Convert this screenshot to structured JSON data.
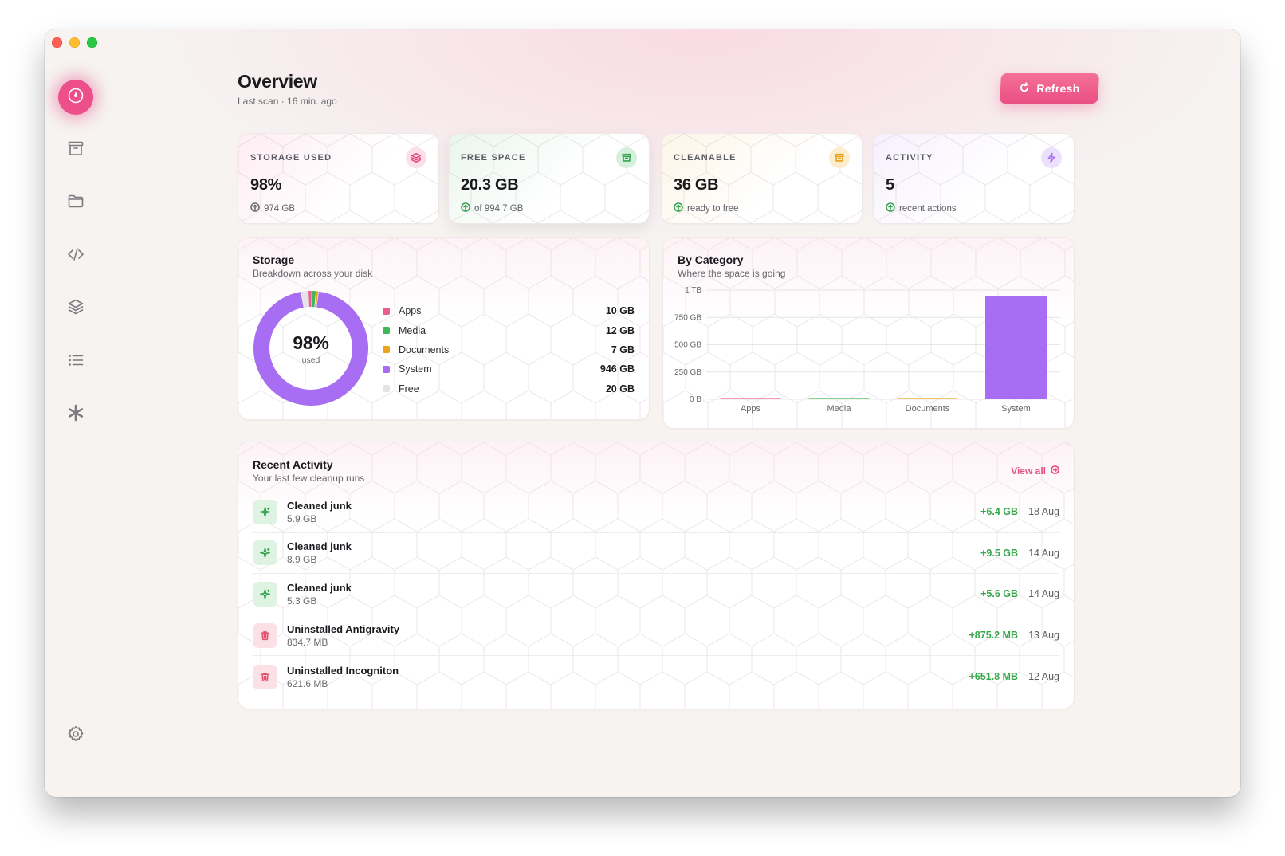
{
  "page": {
    "title": "Overview",
    "last_scan": "Last scan · 16 min. ago",
    "refresh_label": "Refresh"
  },
  "sidebar": {
    "items": [
      {
        "name": "dashboard",
        "icon": "gauge-icon",
        "active": true
      },
      {
        "name": "archive",
        "icon": "archive-icon",
        "active": false
      },
      {
        "name": "folders",
        "icon": "folder-icon",
        "active": false
      },
      {
        "name": "developer",
        "icon": "code-icon",
        "active": false
      },
      {
        "name": "layers",
        "icon": "layers-icon",
        "active": false
      },
      {
        "name": "list",
        "icon": "list-icon",
        "active": false
      },
      {
        "name": "extras",
        "icon": "asterisk-icon",
        "active": false
      }
    ],
    "settings_icon": "gear-icon"
  },
  "stats": [
    {
      "label": "STORAGE USED",
      "value": "98%",
      "sub": "974 GB",
      "color": "#e44f86",
      "icon": "layers-icon"
    },
    {
      "label": "FREE SPACE",
      "value": "20.3 GB",
      "sub": "of 994.7 GB",
      "color": "#35a350",
      "icon": "archive-icon"
    },
    {
      "label": "CLEANABLE",
      "value": "36 GB",
      "sub": "ready to free",
      "color": "#e3a21a",
      "icon": "archive-icon"
    },
    {
      "label": "ACTIVITY",
      "value": "5",
      "sub": "recent actions",
      "color": "#a86ef0",
      "icon": "bolt-icon"
    }
  ],
  "storage": {
    "title": "Storage",
    "subtitle": "Breakdown across your disk",
    "percent": "98%",
    "percent_caption": "used",
    "legend": [
      {
        "name": "Apps",
        "value": "10 GB",
        "color": "#ec5d8f",
        "gb": 10
      },
      {
        "name": "Media",
        "value": "12 GB",
        "color": "#41b75a",
        "gb": 12
      },
      {
        "name": "Documents",
        "value": "7 GB",
        "color": "#eca41c",
        "gb": 7
      },
      {
        "name": "System",
        "value": "946 GB",
        "color": "#a76df2",
        "gb": 946
      },
      {
        "name": "Free",
        "value": "20 GB",
        "color": "#e4e4e6",
        "gb": 20
      }
    ]
  },
  "category": {
    "title": "By Category",
    "subtitle": "Where the space is going"
  },
  "chart_data": {
    "type": "bar",
    "categories": [
      "Apps",
      "Media",
      "Documents",
      "System"
    ],
    "values": [
      10,
      12,
      7,
      946
    ],
    "unit": "GB",
    "colors": [
      "#ec5d8f",
      "#41b75a",
      "#eca41c",
      "#a76df2"
    ],
    "ylim": [
      0,
      1000
    ],
    "yticks": [
      0,
      250,
      500,
      750,
      1000
    ],
    "ytick_labels": [
      "0 B",
      "250 GB",
      "500 GB",
      "750 GB",
      "1 TB"
    ],
    "title": "",
    "xlabel": "",
    "ylabel": "",
    "grid": true
  },
  "activity": {
    "title": "Recent Activity",
    "subtitle": "Your last few cleanup runs",
    "view_all": "View all",
    "rows": [
      {
        "title": "Cleaned junk",
        "size": "5.9 GB",
        "gain": "+6.4 GB",
        "date": "18 Aug",
        "kind": "clean",
        "icon": "sparkle-icon"
      },
      {
        "title": "Cleaned junk",
        "size": "8.9 GB",
        "gain": "+9.5 GB",
        "date": "14 Aug",
        "kind": "clean",
        "icon": "sparkle-icon"
      },
      {
        "title": "Cleaned junk",
        "size": "5.3 GB",
        "gain": "+5.6 GB",
        "date": "14 Aug",
        "kind": "clean",
        "icon": "sparkle-icon"
      },
      {
        "title": "Uninstalled Antigravity",
        "size": "834.7 MB",
        "gain": "+875.2 MB",
        "date": "13 Aug",
        "kind": "uninstall",
        "icon": "trash-icon"
      },
      {
        "title": "Uninstalled Incogniton",
        "size": "621.6 MB",
        "gain": "+651.8 MB",
        "date": "12 Aug",
        "kind": "uninstall",
        "icon": "trash-icon"
      }
    ]
  },
  "colors": {
    "accent": "#ec4f8a",
    "gain": "#38a84d"
  }
}
